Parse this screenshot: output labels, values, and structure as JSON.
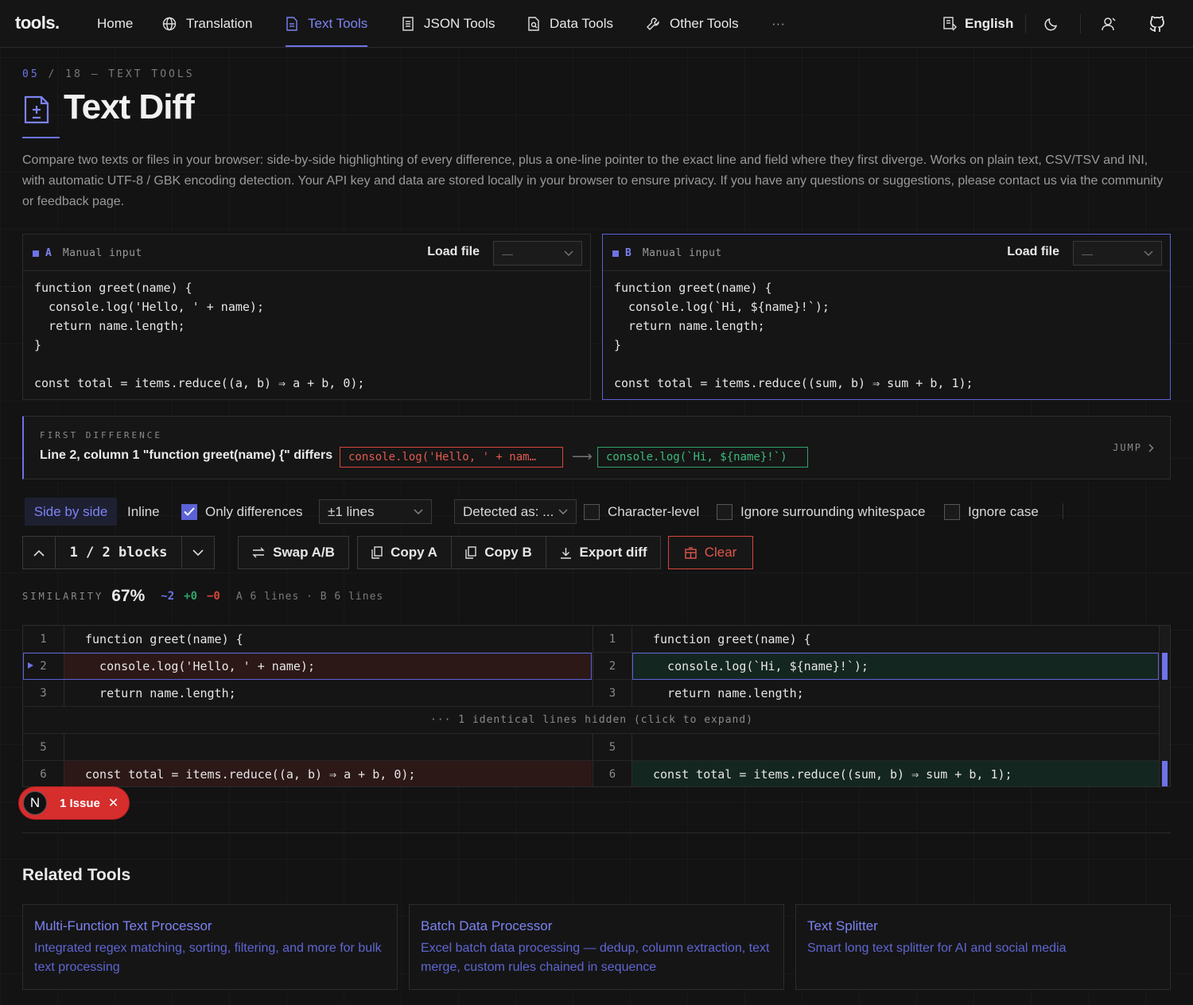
{
  "nav": {
    "logo": "tools.",
    "items": [
      {
        "label": "Home"
      },
      {
        "label": "Translation"
      },
      {
        "label": "Text Tools"
      },
      {
        "label": "JSON Tools"
      },
      {
        "label": "Data Tools"
      },
      {
        "label": "Other Tools"
      }
    ],
    "more": "···",
    "language": "English"
  },
  "header": {
    "crumb_num": "05",
    "crumb_rest": "/ 18 — TEXT TOOLS",
    "title": "Text Diff",
    "description": "Compare two texts or files in your browser: side-by-side highlighting of every difference, plus a one-line pointer to the exact line and field where they first diverge. Works on plain text, CSV/TSV and INI, with automatic UTF-8 / GBK encoding detection. Your API key and data are stored locally in your browser to ensure privacy. If you have any questions or suggestions, please contact us via the community or feedback page."
  },
  "panels": {
    "a": {
      "letter": "A",
      "mode": "Manual input",
      "load_label": "Load file",
      "select_value": "—",
      "code": "function greet(name) {\n  console.log('Hello, ' + name);\n  return name.length;\n}\n\nconst total = items.reduce((a, b) ⇒ a + b, 0);"
    },
    "b": {
      "letter": "B",
      "mode": "Manual input",
      "load_label": "Load file",
      "select_value": "—",
      "code": "function greet(name) {\n  console.log(`Hi, ${name}!`);\n  return name.length;\n}\n\nconst total = items.reduce((sum, b) ⇒ sum + b, 1);"
    }
  },
  "first_difference": {
    "label": "FIRST DIFFERENCE",
    "text": "Line 2, column 1 \"function greet(name) {\" differs",
    "old": "console.log('Hello, ' + nam…",
    "arrow": "⟶",
    "new": "console.log(`Hi, ${name}!`)",
    "jump": "JUMP"
  },
  "options": {
    "side_by_side": "Side by side",
    "inline": "Inline",
    "only_differences": "Only differences",
    "context_select": "±1 lines",
    "detected_select": "Detected as: ...",
    "character_level": "Character-level",
    "ignore_whitespace": "Ignore surrounding whitespace",
    "ignore_case": "Ignore case"
  },
  "actions": {
    "blocks": "1 / 2 blocks",
    "swap": "Swap A/B",
    "copy_a": "Copy A",
    "copy_b": "Copy B",
    "export": "Export diff",
    "clear": "Clear"
  },
  "similarity": {
    "label": "SIMILARITY",
    "value": "67%",
    "changed": "~2",
    "added": "+0",
    "removed": "−0",
    "lines": "A 6 lines · B 6 lines"
  },
  "diff": {
    "rows": [
      {
        "a_num": "1",
        "a_code": "function greet(name) {",
        "b_num": "1",
        "b_code": "function greet(name) {"
      },
      {
        "a_num": "2",
        "a_code": "  console.log('Hello, ' + name);",
        "b_num": "2",
        "b_code": "  console.log(`Hi, ${name}!`);"
      },
      {
        "a_num": "3",
        "a_code": "  return name.length;",
        "b_num": "3",
        "b_code": "  return name.length;"
      },
      {
        "a_num": "5",
        "a_code": "",
        "b_num": "5",
        "b_code": ""
      },
      {
        "a_num": "6",
        "a_code": "const total = items.reduce((a, b) ⇒ a + b, 0);",
        "b_num": "6",
        "b_code": "const total = items.reduce((sum, b) ⇒ sum + b, 1);"
      }
    ],
    "hidden_note": "··· 1 identical lines hidden (click to expand)"
  },
  "issue_badge": {
    "letter": "N",
    "text": "1 Issue",
    "close": "✕"
  },
  "related": {
    "title": "Related Tools",
    "cards": [
      {
        "title": "Multi-Function Text Processor",
        "desc": "Integrated regex matching, sorting, filtering, and more for bulk text processing"
      },
      {
        "title": "Batch Data Processor",
        "desc": "Excel batch data processing — dedup, column extraction, text merge, custom rules chained in sequence"
      },
      {
        "title": "Text Splitter",
        "desc": "Smart long text splitter for AI and social media"
      }
    ]
  },
  "colors": {
    "accent": "#6d73e8",
    "deleted": "#d6463c",
    "added": "#2fa36a",
    "background": "#131313"
  }
}
